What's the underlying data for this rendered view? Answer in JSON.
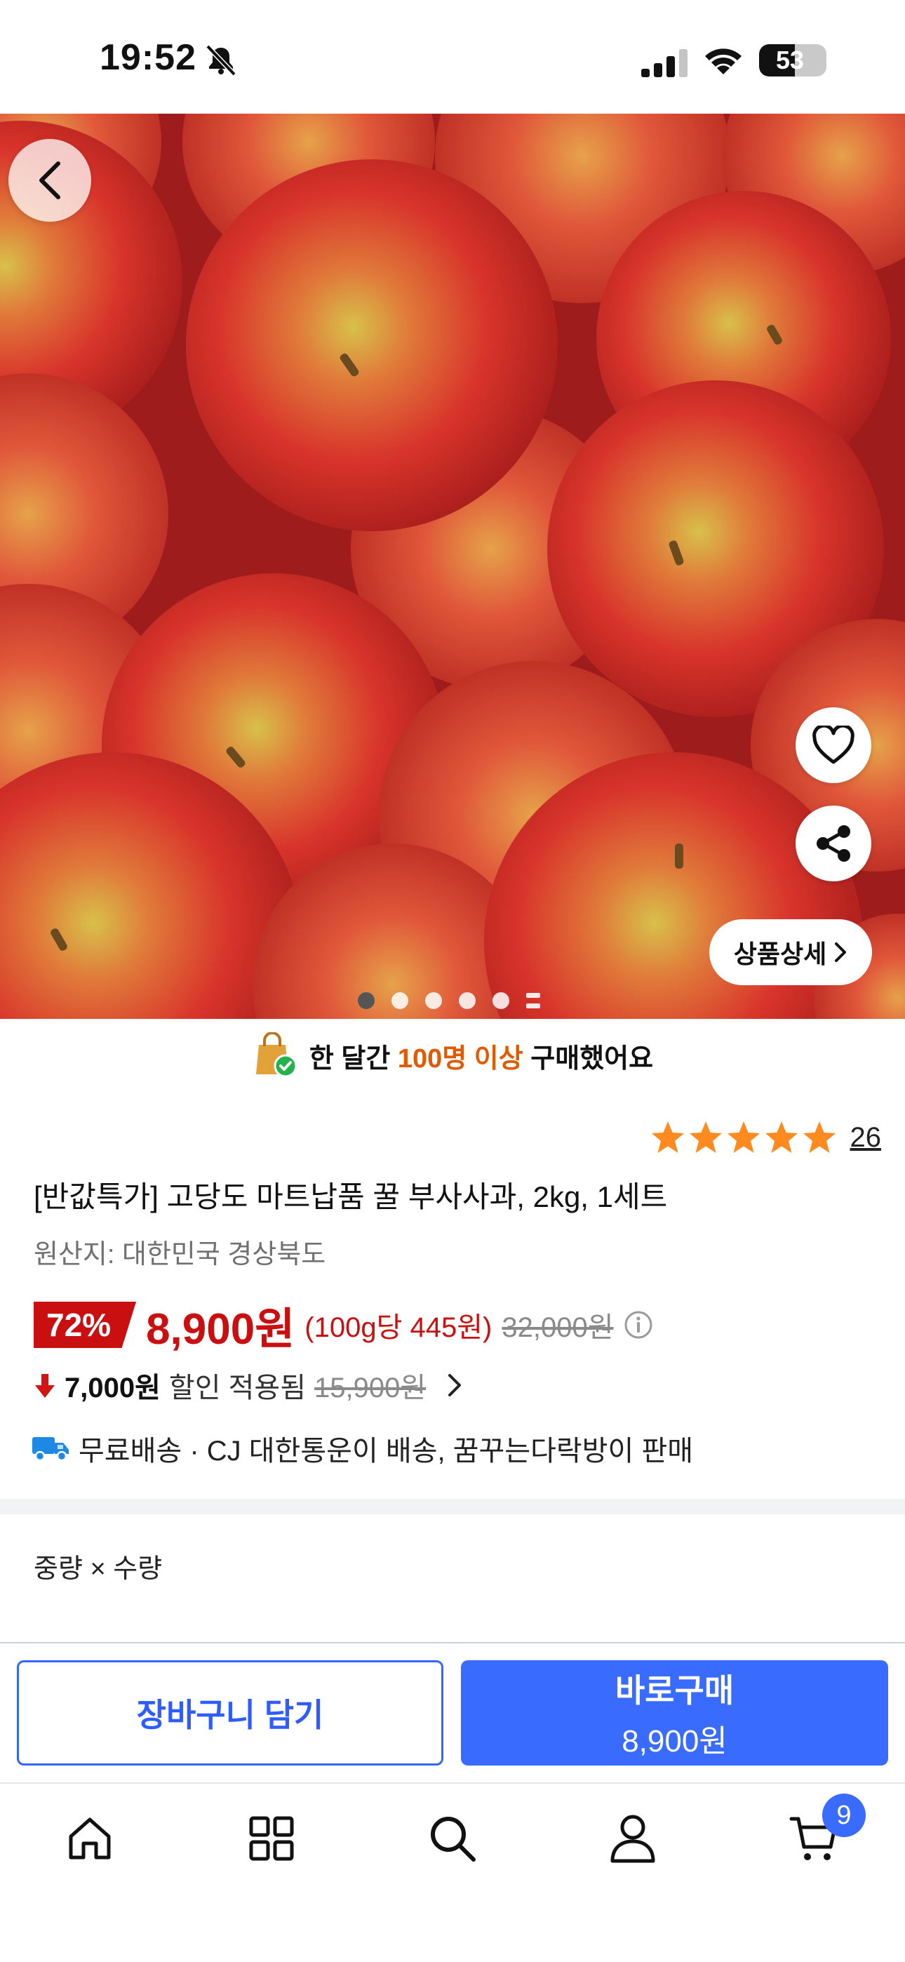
{
  "status_bar": {
    "time": "19:52",
    "battery": "53",
    "battery_level": 0.53
  },
  "hero": {
    "slides_total": 6,
    "active_slide": 1,
    "detail_button_label": "상품상세"
  },
  "banner": {
    "prefix": "한 달간 ",
    "highlight": "100명 이상",
    "suffix": " 구매했어요",
    "accent_color": "#e05a00"
  },
  "product": {
    "rating_stars": 5,
    "review_count": "26",
    "title": "[반값특가] 고당도 마트납품 꿀 부사사과, 2kg, 1세트",
    "origin": "원산지: 대한민국 경상북도"
  },
  "price": {
    "discount_rate": "72%",
    "sale_price": "8,900원",
    "unit_price": "(100g당 445원)",
    "original_price": "32,000원",
    "price_color": "#c90f0f"
  },
  "coupon": {
    "amount": "7,000원",
    "text": "할인 적용됨",
    "before_price": "15,900원"
  },
  "delivery": {
    "text": "무료배송 · CJ 대한통운이 배송, 꿈꾸는다락방이 판매"
  },
  "options": {
    "label": "중량 × 수량"
  },
  "actions": {
    "cart_label": "장바구니 담기",
    "buy_label": "바로구매",
    "buy_price": "8,900원",
    "primary_color": "#3a6bff"
  },
  "tabbar": {
    "items": [
      {
        "name": "home",
        "icon": "home-icon"
      },
      {
        "name": "categories",
        "icon": "grid-icon"
      },
      {
        "name": "search",
        "icon": "search-icon"
      },
      {
        "name": "my-page",
        "icon": "user-icon"
      },
      {
        "name": "cart",
        "icon": "cart-icon"
      }
    ],
    "cart_count": "9"
  }
}
